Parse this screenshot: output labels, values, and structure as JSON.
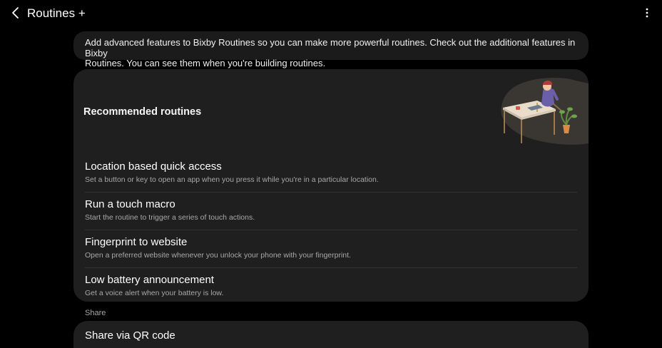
{
  "header": {
    "title": "Routines +",
    "back_icon": "chevron-left-icon",
    "more_icon": "more-vertical-icon"
  },
  "info": {
    "text_line1": "Add advanced features to Bixby Routines so you can make more powerful routines. Check out the additional features in Bixby",
    "text_line2": "Routines. You can see them when you're building routines."
  },
  "recommended": {
    "title": "Recommended routines",
    "illustration": "person-at-desk-illustration",
    "items": [
      {
        "title": "Location based quick access",
        "desc": "Set a button or key to open an app when you press it while you're in a particular location."
      },
      {
        "title": "Run a touch macro",
        "desc": "Start the routine to trigger a series of touch actions."
      },
      {
        "title": "Fingerprint to website",
        "desc": "Open a preferred website whenever you unlock your phone with your fingerprint."
      },
      {
        "title": "Low battery announcement",
        "desc": "Get a voice alert when your battery is low."
      }
    ]
  },
  "share": {
    "label": "Share",
    "item_title": "Share via QR code"
  },
  "colors": {
    "background": "#000000",
    "card": "#1f1f1f",
    "secondary_text": "#a8a8a8"
  }
}
